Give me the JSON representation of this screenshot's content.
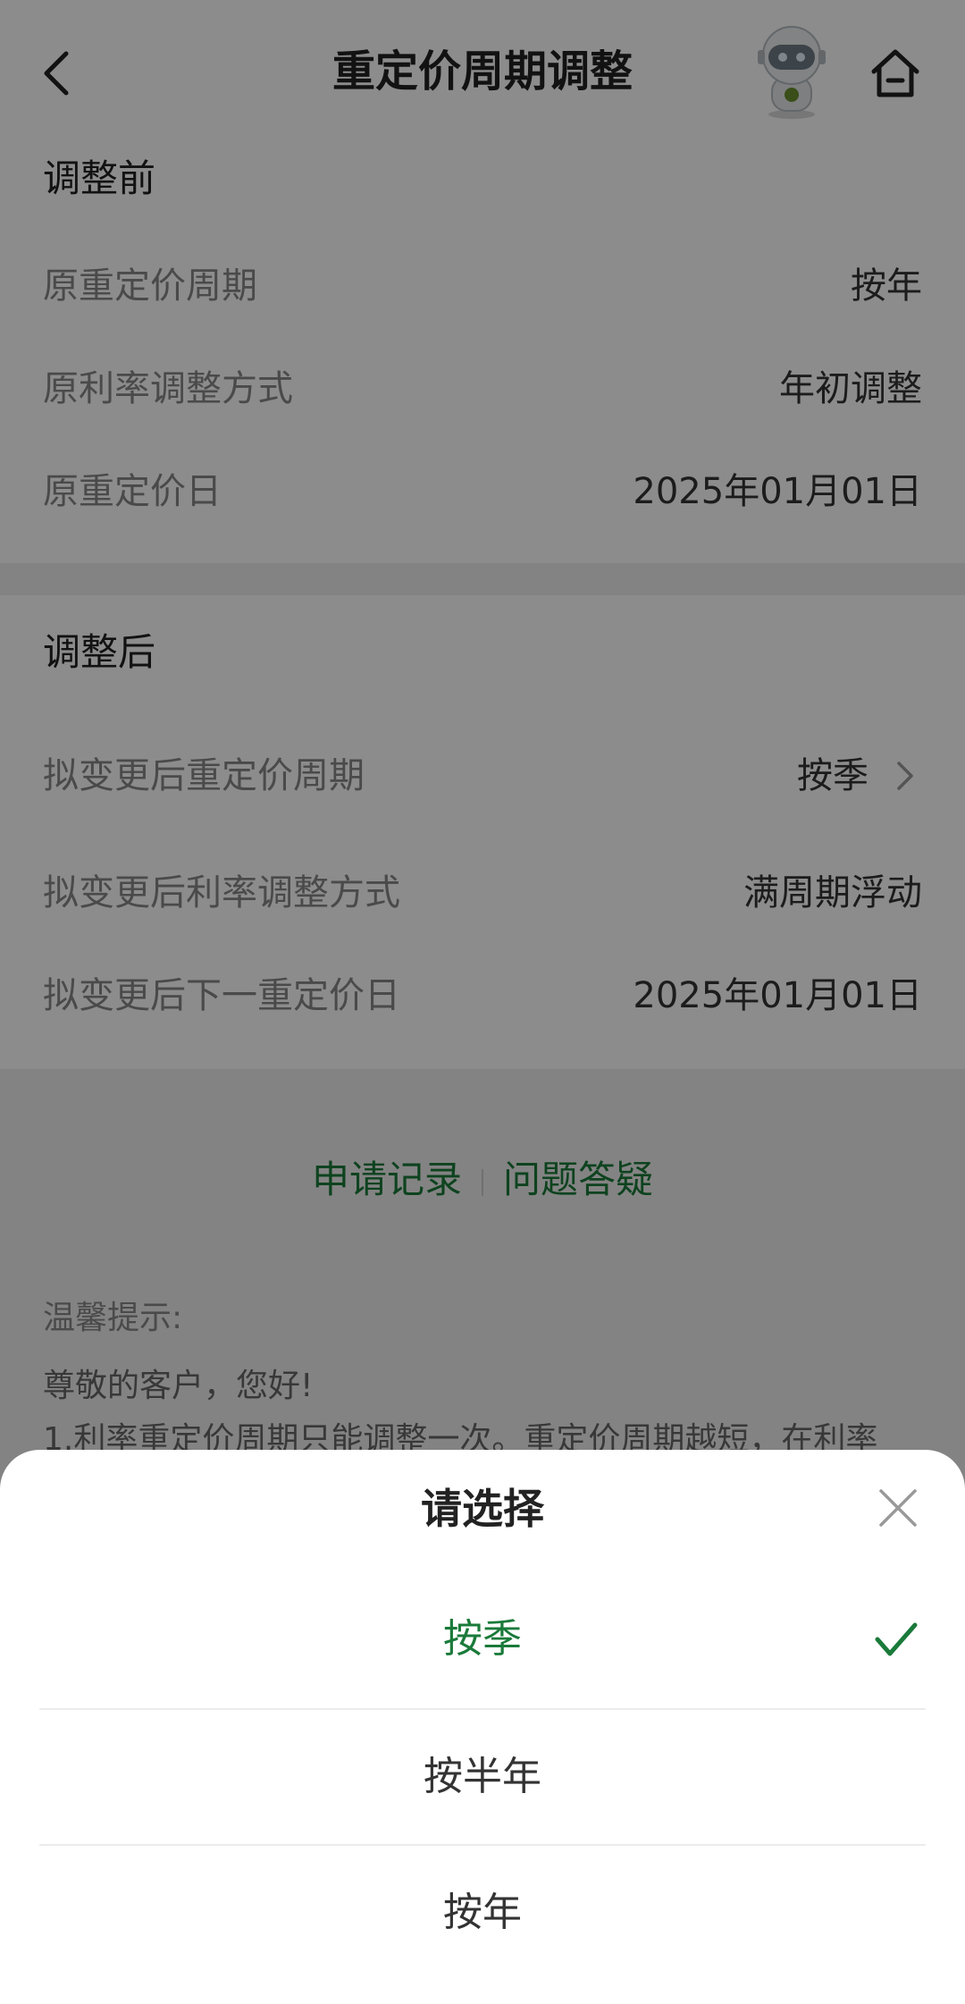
{
  "header": {
    "title": "重定价周期调整"
  },
  "before": {
    "title": "调整前",
    "rows": [
      {
        "label": "原重定价周期",
        "value": "按年"
      },
      {
        "label": "原利率调整方式",
        "value": "年初调整"
      },
      {
        "label": "原重定价日",
        "value": "2025年01月01日"
      }
    ]
  },
  "after": {
    "title": "调整后",
    "rows": [
      {
        "label": "拟变更后重定价周期",
        "value": "按季"
      },
      {
        "label": "拟变更后利率调整方式",
        "value": "满周期浮动"
      },
      {
        "label": "拟变更后下一重定价日",
        "value": "2025年01月01日"
      }
    ]
  },
  "links": {
    "records": "申请记录",
    "faq": "问题答疑"
  },
  "tips": {
    "title": "温馨提示:",
    "lines": [
      " 尊敬的客户，您好!",
      "1.利率重定价周期只能调整一次。重定价周期越短，在利率"
    ]
  },
  "sheet": {
    "title": "请选择",
    "options": [
      {
        "label": "按季",
        "selected": true
      },
      {
        "label": "按半年",
        "selected": false
      },
      {
        "label": "按年",
        "selected": false
      }
    ]
  },
  "colors": {
    "accent_green": "#1a7a3a",
    "mask": "rgba(0,0,0,0.45)"
  },
  "icons": [
    "back-icon",
    "robot-avatar",
    "home-icon",
    "chevron-right-icon",
    "close-icon",
    "check-icon"
  ]
}
